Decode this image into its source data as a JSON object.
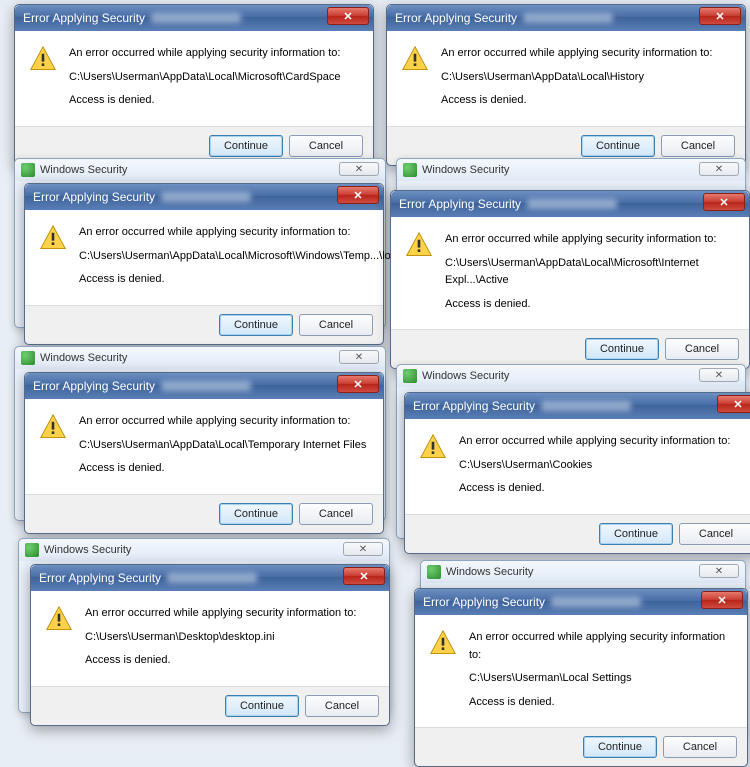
{
  "common": {
    "title": "Error Applying Security",
    "parent_title": "Windows Security",
    "message_intro": "An error occurred while applying security information to:",
    "access_denied": "Access is denied.",
    "continue_label": "Continue",
    "cancel_label": "Cancel",
    "close_glyph": "✕",
    "parent_close_glyph": "✕"
  },
  "dialogs": [
    {
      "path": "C:\\Users\\Userman\\AppData\\Local\\Microsoft\\CardSpace"
    },
    {
      "path": "C:\\Users\\Userman\\AppData\\Local\\History"
    },
    {
      "path": "C:\\Users\\Userman\\AppData\\Local\\Microsoft\\Windows\\Temp...\\log"
    },
    {
      "path": "C:\\Users\\Userman\\AppData\\Local\\Microsoft\\Internet Expl...\\Active"
    },
    {
      "path": "C:\\Users\\Userman\\AppData\\Local\\Temporary Internet Files"
    },
    {
      "path": "C:\\Users\\Userman\\Cookies"
    },
    {
      "path": "C:\\Users\\Userman\\Desktop\\desktop.ini"
    },
    {
      "path": "C:\\Users\\Userman\\Local Settings"
    }
  ]
}
